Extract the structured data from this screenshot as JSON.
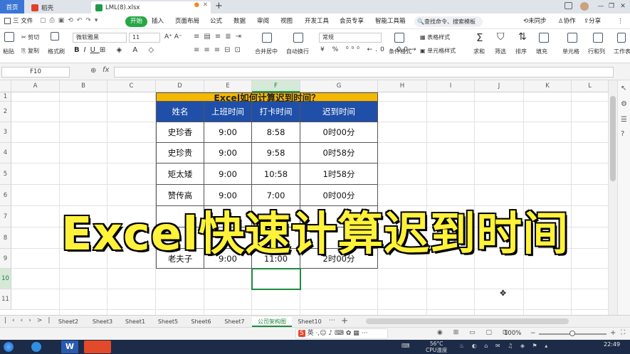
{
  "window": {
    "tabs": [
      {
        "label": "首页"
      },
      {
        "label": "稻壳"
      },
      {
        "label": "LML(8).xlsx"
      }
    ],
    "new_tab": "+"
  },
  "menu": {
    "file": "三 文件",
    "items": [
      "开始",
      "插入",
      "页面布局",
      "公式",
      "数据",
      "审阅",
      "视图",
      "开发工具",
      "会员专享",
      "智能工具箱"
    ],
    "search": "查找命令、搜索模板",
    "sync": "未同步",
    "collab": "协作",
    "share": "分享"
  },
  "ribbon": {
    "paste": "粘贴",
    "cut": "剪切",
    "copy": "复制",
    "format_painter": "格式刷",
    "font_name": "微软雅黑",
    "font_size": "11",
    "merge_center": "合并居中",
    "wrap_text": "自动换行",
    "number_format": "常规",
    "conditional_format": "条件格式",
    "table_style": "表格样式",
    "cell_style": "单元格样式",
    "sum": "求和",
    "filter": "筛选",
    "sort": "排序",
    "fill": "填充",
    "cells": "单元格",
    "rows_cols": "行和列",
    "worksheet": "工作表"
  },
  "formula_bar": {
    "name_box": "F10",
    "fx": "fx"
  },
  "grid": {
    "columns": [
      "A",
      "B",
      "C",
      "D",
      "E",
      "F",
      "G",
      "H",
      "I",
      "J",
      "K",
      "L"
    ],
    "rows": [
      "1",
      "2",
      "3",
      "4",
      "5",
      "6",
      "7",
      "8",
      "9",
      "10",
      "11"
    ],
    "selected_column": "F",
    "selected_row": "10"
  },
  "table": {
    "title": "Excel如何计算迟到时间？",
    "headers": [
      "姓名",
      "上班时间",
      "打卡时间",
      "迟到时间"
    ],
    "rows": [
      [
        "史珍香",
        "9:00",
        "8:58",
        "0时00分"
      ],
      [
        "史珍贵",
        "9:00",
        "9:58",
        "0时58分"
      ],
      [
        "矩太矮",
        "9:00",
        "10:58",
        "1时58分"
      ],
      [
        "赞传高",
        "9:00",
        "7:00",
        "0时00分"
      ],
      [
        "",
        "",
        "",
        ""
      ],
      [
        "",
        "",
        "",
        ""
      ],
      [
        "老夫子",
        "9:00",
        "11:00",
        "2时00分"
      ]
    ]
  },
  "caption": "Excel快速计算迟到时间",
  "sheets": {
    "tabs": [
      "Sheet2",
      "Sheet3",
      "Sheet1",
      "Sheet5",
      "Sheet6",
      "Sheet7",
      "公司架构图",
      "Sheet10"
    ],
    "active": "公司架构图"
  },
  "status": {
    "zoom": "100%"
  },
  "taskbar": {
    "temp": "56°C",
    "cpu": "CPU温度",
    "time": "22:49"
  }
}
